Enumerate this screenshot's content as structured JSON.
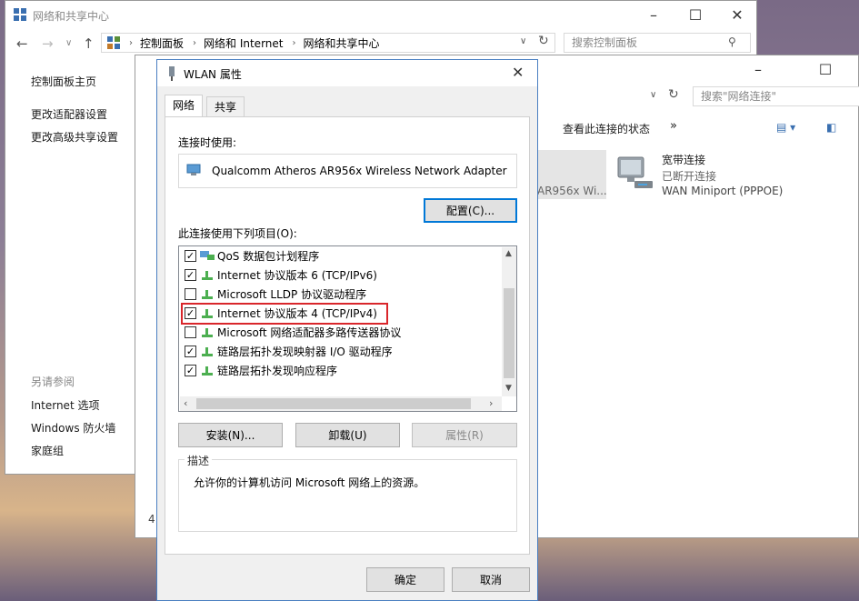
{
  "bg_window": {
    "title": "网络和共享中心",
    "address": [
      "控制面板",
      "网络和 Internet",
      "网络和共享中心"
    ],
    "search_placeholder": "搜索控制面板",
    "left_nav": [
      "控制面板主页",
      "更改适配器设置",
      "更改高级共享设置"
    ],
    "see_also_title": "另请参阅",
    "see_also": [
      "Internet 选项",
      "Windows 防火墙",
      "家庭组"
    ]
  },
  "bg_window2": {
    "search_placeholder": "搜索\"网络连接\"",
    "toolbar_view_status": "查看此连接的状态",
    "toolbar_more": "»",
    "partial_adapter": "AR956x Wi...",
    "broadband": {
      "name": "宽带连接",
      "status": "已断开连接",
      "device": "WAN Miniport (PPPOE)"
    },
    "partial_status_left": "4"
  },
  "dialog": {
    "title": "WLAN 属性",
    "tabs": [
      "网络",
      "共享"
    ],
    "connect_using_label": "连接时使用:",
    "adapter_name": "Qualcomm Atheros AR956x Wireless Network Adapter",
    "configure_button": "配置(C)...",
    "items_label": "此连接使用下列项目(O):",
    "items": [
      {
        "label": "QoS 数据包计划程序",
        "checked": true
      },
      {
        "label": "Internet 协议版本 6 (TCP/IPv6)",
        "checked": true
      },
      {
        "label": "Microsoft LLDP 协议驱动程序",
        "checked": false
      },
      {
        "label": "Internet 协议版本 4 (TCP/IPv4)",
        "checked": true
      },
      {
        "label": "Microsoft 网络适配器多路传送器协议",
        "checked": false
      },
      {
        "label": "链路层拓扑发现映射器 I/O 驱动程序",
        "checked": true
      },
      {
        "label": "链路层拓扑发现响应程序",
        "checked": true
      }
    ],
    "install_button": "安装(N)...",
    "uninstall_button": "卸载(U)",
    "properties_button": "属性(R)",
    "description_title": "描述",
    "description_text": "允许你的计算机访问 Microsoft 网络上的资源。",
    "ok_button": "确定",
    "cancel_button": "取消"
  },
  "colors": {
    "highlight_border": "#d9262b",
    "focus_border": "#0078d7"
  }
}
